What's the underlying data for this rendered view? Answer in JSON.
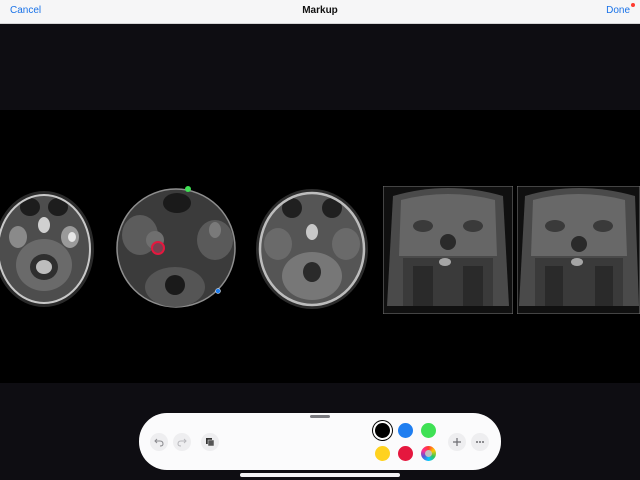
{
  "navbar": {
    "cancel_label": "Cancel",
    "title": "Markup",
    "done_label": "Done"
  },
  "toolbar": {
    "icons": [
      "undo-icon",
      "redo-icon",
      "layers-icon",
      "plus-icon",
      "more-icon"
    ],
    "colors": [
      {
        "name": "black",
        "hex": "#000000",
        "selected": true
      },
      {
        "name": "blue",
        "hex": "#1f7ef0",
        "selected": false
      },
      {
        "name": "green",
        "hex": "#3fe155",
        "selected": false
      },
      {
        "name": "yellow",
        "hex": "#ffd21f",
        "selected": false
      },
      {
        "name": "red",
        "hex": "#e5173e",
        "selected": false
      },
      {
        "name": "multicolor",
        "hex": "multicolor",
        "selected": false
      }
    ]
  },
  "image": {
    "panels": [
      "axial-t2-scan",
      "axial-magnified-scan",
      "axial-t1-scan",
      "coronal-scan-1",
      "coronal-scan-2"
    ]
  }
}
